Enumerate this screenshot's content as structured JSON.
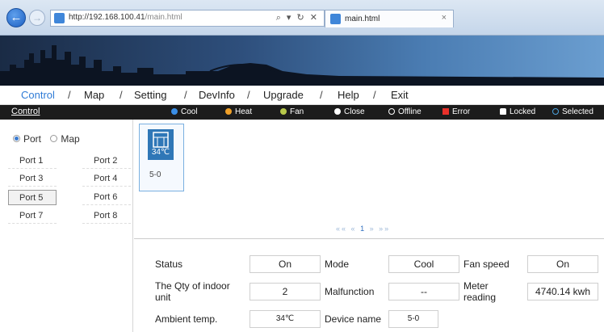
{
  "browser": {
    "url_host": "http://192.168.100.41",
    "url_path": "/main.html",
    "search_tools": "⌕ ▾ ↻ ✕",
    "tab_title": "main.html",
    "tab_close": "×"
  },
  "menu": {
    "items": [
      "Control",
      "Map",
      "Setting",
      "DevInfo",
      "Upgrade",
      "Help",
      "Exit"
    ],
    "separator": "/"
  },
  "legend": {
    "section": "Control",
    "items": [
      {
        "label": "Cool",
        "color": "#3a8ee6"
      },
      {
        "label": "Heat",
        "color": "#f0a028"
      },
      {
        "label": "Fan",
        "color": "#b7c84a"
      },
      {
        "label": "Close",
        "color": "#ffffff"
      },
      {
        "label": "Offline",
        "color": "hollow"
      },
      {
        "label": "Error",
        "color": "#e8302a"
      },
      {
        "label": "Locked",
        "color": "lock"
      },
      {
        "label": "Selected",
        "color": "#4aa3df"
      }
    ]
  },
  "sidebar": {
    "view_options": [
      {
        "label": "Port",
        "selected": true
      },
      {
        "label": "Map",
        "selected": false
      }
    ],
    "ports": [
      "Port 1",
      "Port 2",
      "Port 3",
      "Port 4",
      "Port 5",
      "Port 6",
      "Port 7",
      "Port 8"
    ],
    "selected_port": "Port 5"
  },
  "units": [
    {
      "id": "5-0",
      "temperature": "34℃",
      "mode_color": "#2f77b7",
      "icon": "indoor-unit-icon"
    }
  ],
  "pager": {
    "first": "««",
    "prev": "«",
    "current": "1",
    "next": "»",
    "last": "»»"
  },
  "details": {
    "status_label": "Status",
    "status_value": "On",
    "mode_label": "Mode",
    "mode_value": "Cool",
    "fan_label": "Fan speed",
    "fan_value": "On",
    "qty_label": "The Qty of indoor unit",
    "qty_value": "2",
    "malfunction_label": "Malfunction",
    "malfunction_value": "--",
    "meter_label": "Meter reading",
    "meter_value": "4740.14 kwh",
    "ambient_label": "Ambient temp.",
    "ambient_value": "34℃",
    "device_label": "Device name",
    "device_value": "5-0"
  }
}
